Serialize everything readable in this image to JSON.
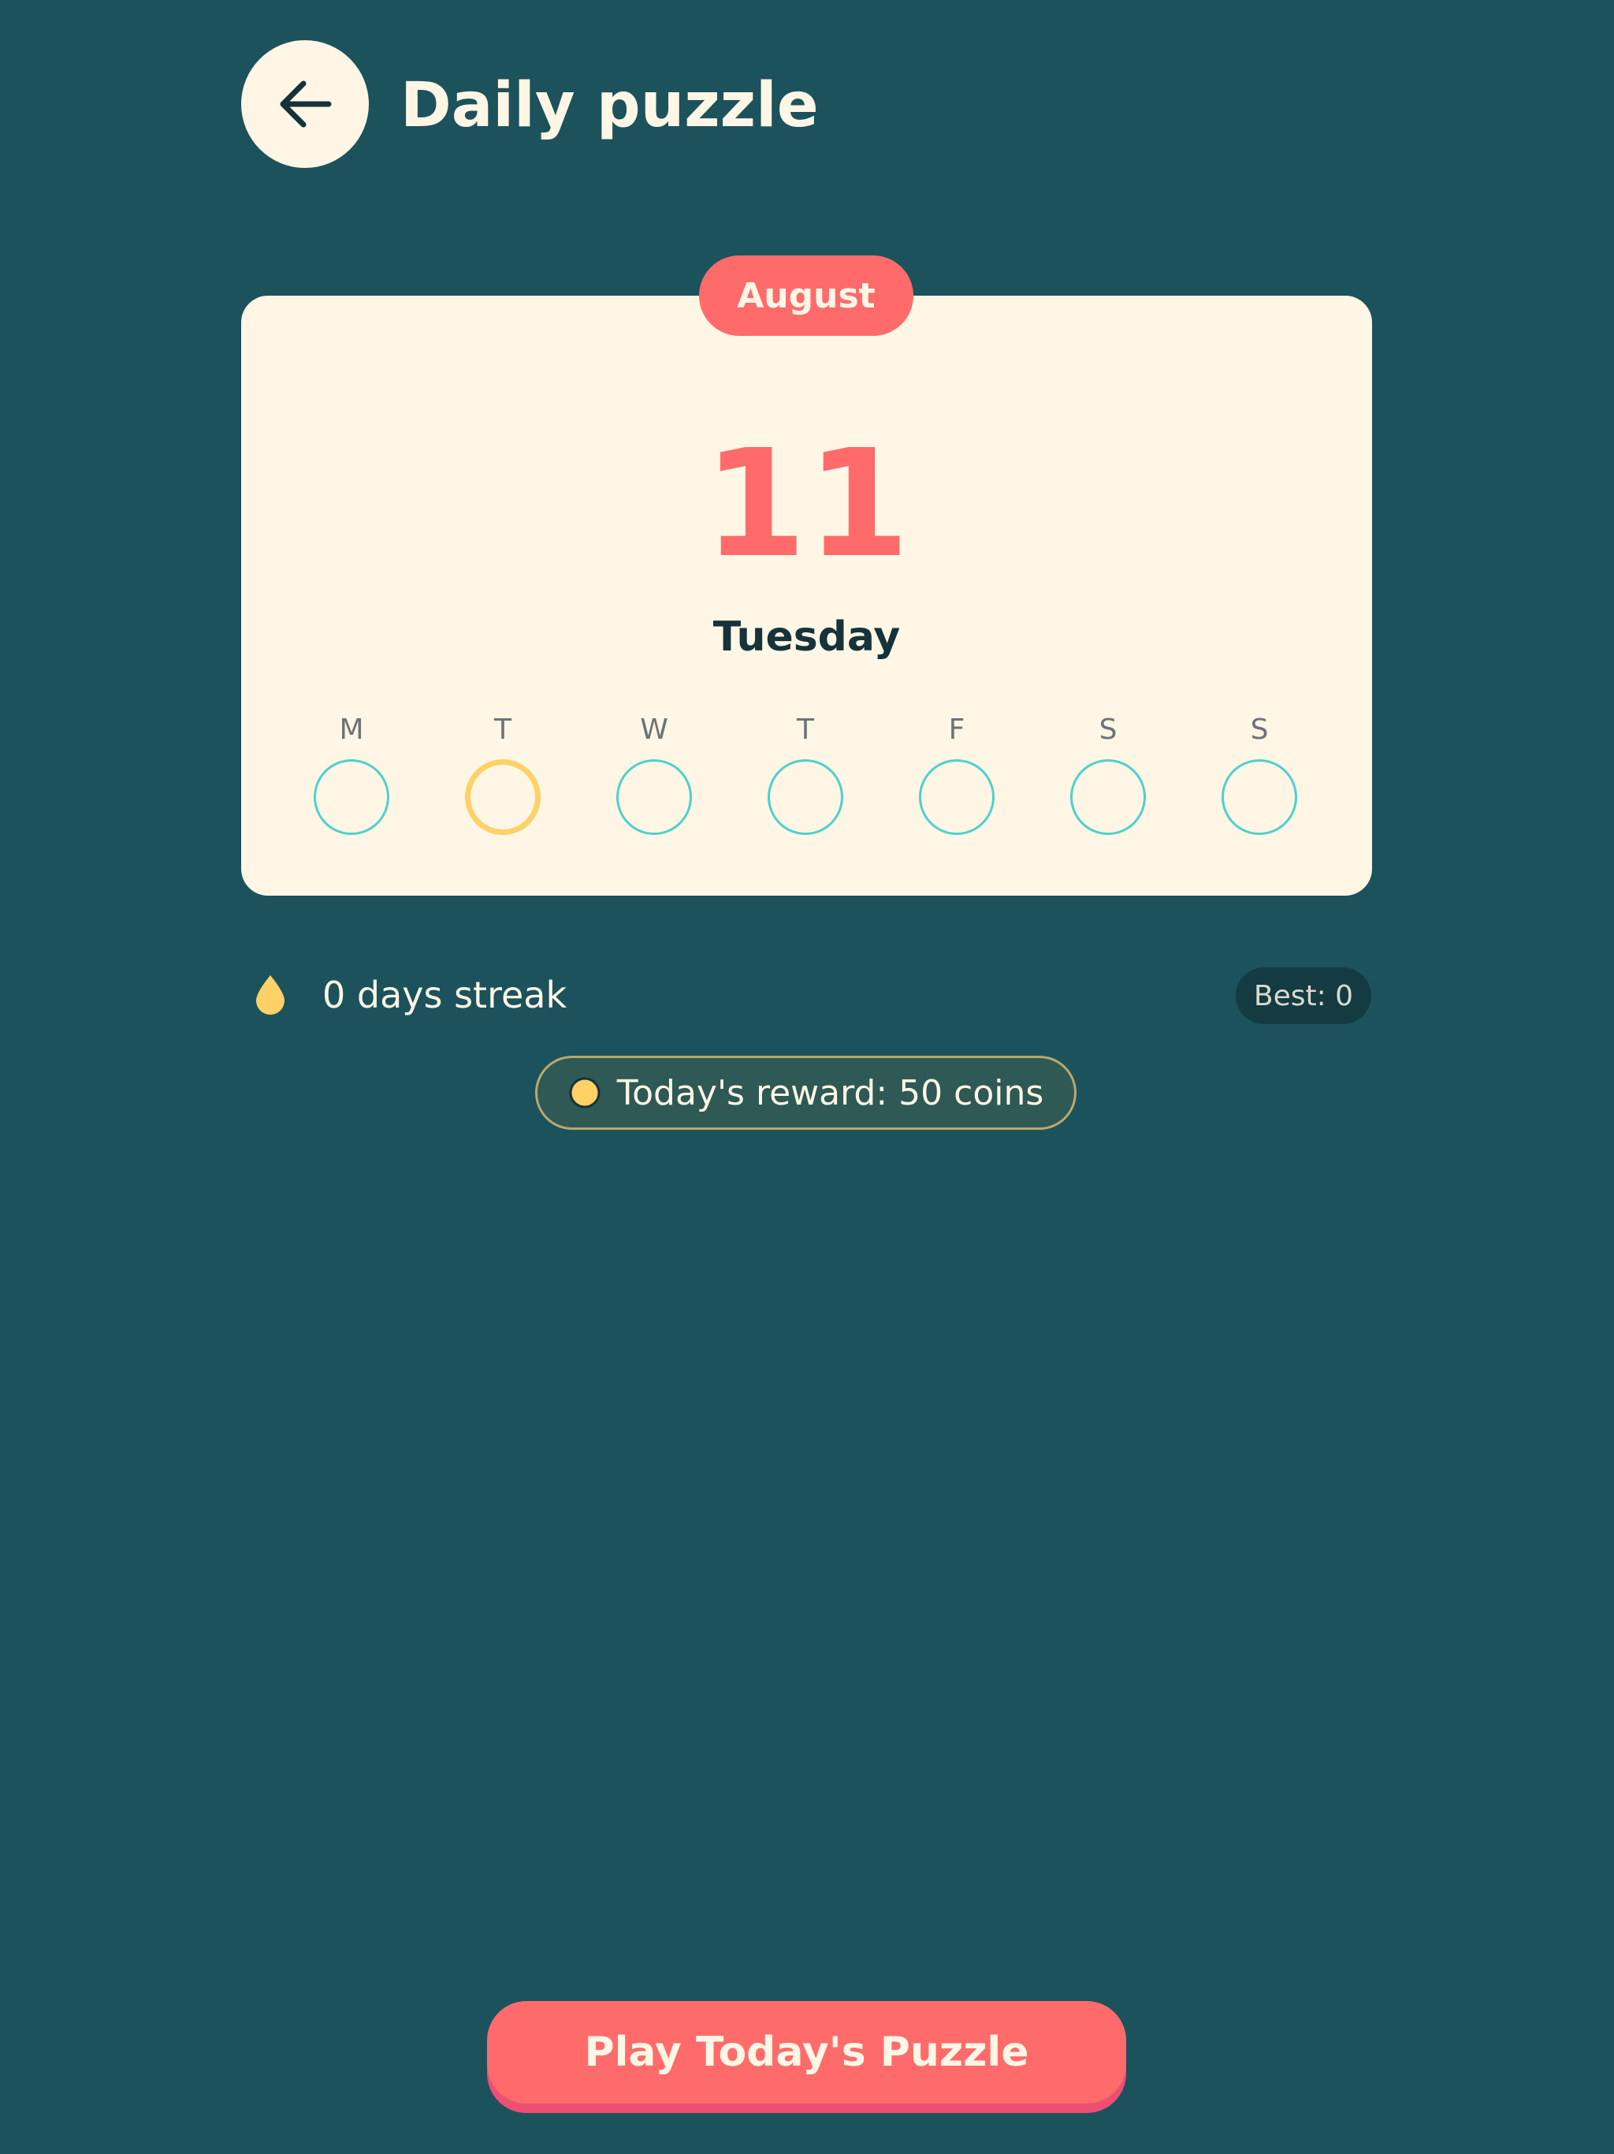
{
  "header": {
    "back_icon": "arrow-left-icon",
    "title": "Daily puzzle"
  },
  "calendar": {
    "month": "August",
    "day_number": "11",
    "weekday": "Tuesday",
    "week": [
      {
        "letter": "M",
        "today": false
      },
      {
        "letter": "T",
        "today": true
      },
      {
        "letter": "W",
        "today": false
      },
      {
        "letter": "T",
        "today": false
      },
      {
        "letter": "F",
        "today": false
      },
      {
        "letter": "S",
        "today": false
      },
      {
        "letter": "S",
        "today": false
      }
    ]
  },
  "streak": {
    "icon": "flame-icon",
    "text": "0 days streak",
    "best": "Best: 0"
  },
  "reward": {
    "icon": "coin-icon",
    "text": "Today's reward: 50 coins"
  },
  "play_button": {
    "label": "Play Today's Puzzle"
  },
  "colors": {
    "background": "#1c525c",
    "card": "#fff6e5",
    "accent": "#ff6b6b",
    "teal": "#4ed1cb",
    "gold": "#ffd166"
  }
}
